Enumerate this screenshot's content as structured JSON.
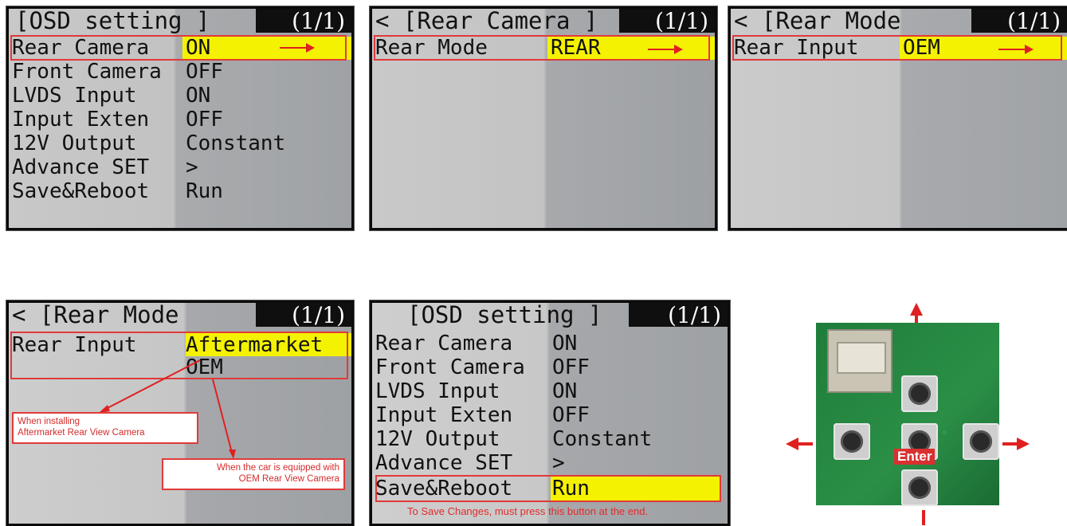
{
  "panel1": {
    "title": "[OSD setting ]",
    "page": "(1/1)",
    "rows": [
      {
        "label": "Rear Camera",
        "value": "ON"
      },
      {
        "label": "Front Camera",
        "value": "OFF"
      },
      {
        "label": "LVDS Input",
        "value": "ON"
      },
      {
        "label": "Input Exten",
        "value": "OFF"
      },
      {
        "label": "12V Output",
        "value": "Constant"
      },
      {
        "label": "Advance SET",
        "value": ">"
      },
      {
        "label": "Save&Reboot",
        "value": "Run"
      }
    ]
  },
  "panel2": {
    "title": "< [Rear Camera ]",
    "page": "(1/1)",
    "rows": [
      {
        "label": "Rear Mode",
        "value": "REAR"
      }
    ]
  },
  "panel3": {
    "title": "< [Rear Mode      ]",
    "page": "(1/1)",
    "rows": [
      {
        "label": "Rear Input",
        "value": "OEM"
      }
    ]
  },
  "panel4": {
    "title": "< [Rear Mode      ]",
    "page": "(1/1)",
    "rows": [
      {
        "label": "Rear Input",
        "value": "Aftermarket"
      },
      {
        "label": "",
        "value": "OEM"
      }
    ],
    "callout_aftermarket": "When installing\nAftermarket Rear View Camera",
    "callout_oem": "When the car is equipped with\nOEM Rear View Camera"
  },
  "panel5": {
    "title": "[OSD setting ]",
    "page": "(1/1)",
    "rows": [
      {
        "label": "Rear Camera",
        "value": "ON"
      },
      {
        "label": "Front Camera",
        "value": "OFF"
      },
      {
        "label": "LVDS Input",
        "value": "ON"
      },
      {
        "label": "Input Exten",
        "value": "OFF"
      },
      {
        "label": "12V Output",
        "value": "Constant"
      },
      {
        "label": "Advance SET",
        "value": ">"
      },
      {
        "label": "Save&Reboot",
        "value": "Run"
      }
    ],
    "note": "To Save Changes, must press this button at the end."
  },
  "keypad": {
    "enter_label": "Enter"
  },
  "colors": {
    "highlight": "#f4f200",
    "annotation_red": "#e03a3a"
  }
}
